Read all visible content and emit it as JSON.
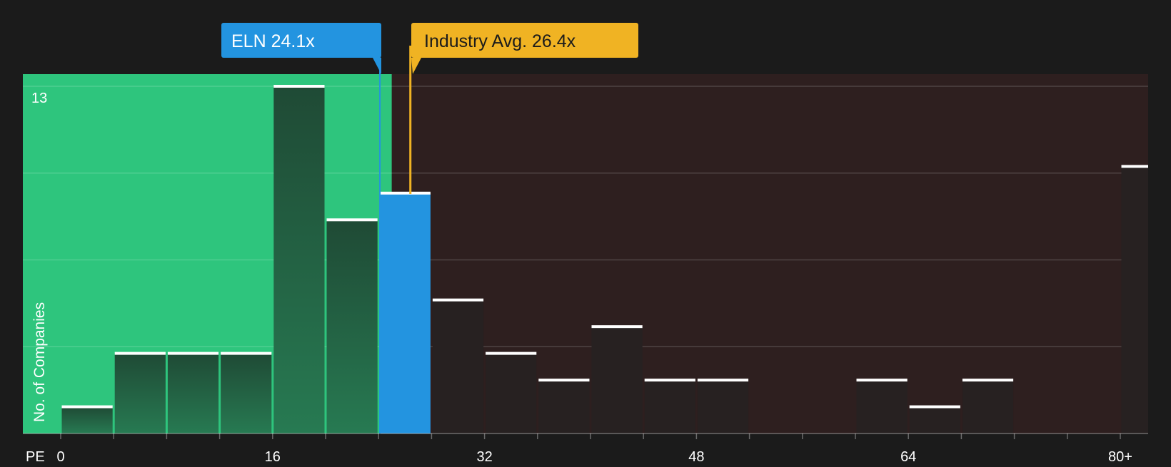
{
  "chart_data": {
    "type": "bar",
    "x_axis_label": "PE",
    "y_axis_label": "No. of Companies",
    "y_max_label": "13",
    "ylim": [
      0,
      13.5
    ],
    "bin_width": 4,
    "bins": [
      {
        "start": 0,
        "count": 1
      },
      {
        "start": 4,
        "count": 3
      },
      {
        "start": 8,
        "count": 3
      },
      {
        "start": 12,
        "count": 3
      },
      {
        "start": 16,
        "count": 13
      },
      {
        "start": 20,
        "count": 8
      },
      {
        "start": 24,
        "count": 9,
        "highlight": true
      },
      {
        "start": 28,
        "count": 5
      },
      {
        "start": 32,
        "count": 3
      },
      {
        "start": 36,
        "count": 2
      },
      {
        "start": 40,
        "count": 4
      },
      {
        "start": 44,
        "count": 2
      },
      {
        "start": 48,
        "count": 2
      },
      {
        "start": 52,
        "count": 0
      },
      {
        "start": 56,
        "count": 0
      },
      {
        "start": 60,
        "count": 2
      },
      {
        "start": 64,
        "count": 1
      },
      {
        "start": 68,
        "count": 2
      },
      {
        "start": 72,
        "count": 0
      },
      {
        "start": 76,
        "count": 0
      },
      {
        "start": 80,
        "count": 10
      }
    ],
    "x_ticks": [
      {
        "value": 0,
        "label": "0"
      },
      {
        "value": 16,
        "label": "16"
      },
      {
        "value": 32,
        "label": "32"
      },
      {
        "value": 48,
        "label": "48"
      },
      {
        "value": 64,
        "label": "64"
      },
      {
        "value": 80,
        "label": "80+"
      }
    ],
    "markers": [
      {
        "name": "company",
        "label": "ELN 24.1x",
        "value": 24.1,
        "color": "#2394e0"
      },
      {
        "name": "industry",
        "label": "Industry Avg. 26.4x",
        "value": 26.4,
        "color": "#f0b323"
      }
    ],
    "undervalued_until": 25.0,
    "colors": {
      "background": "#1b1b1b",
      "green_zone": "#2ec57d",
      "red_zone": "#2e1f1f",
      "bar_green": "#24553d",
      "bar_dark": "#272121",
      "bar_highlight": "#2394e0",
      "bar_cap": "#ffffff",
      "text": "#ffffff",
      "label_dark_text": "#1b1b1b"
    }
  }
}
